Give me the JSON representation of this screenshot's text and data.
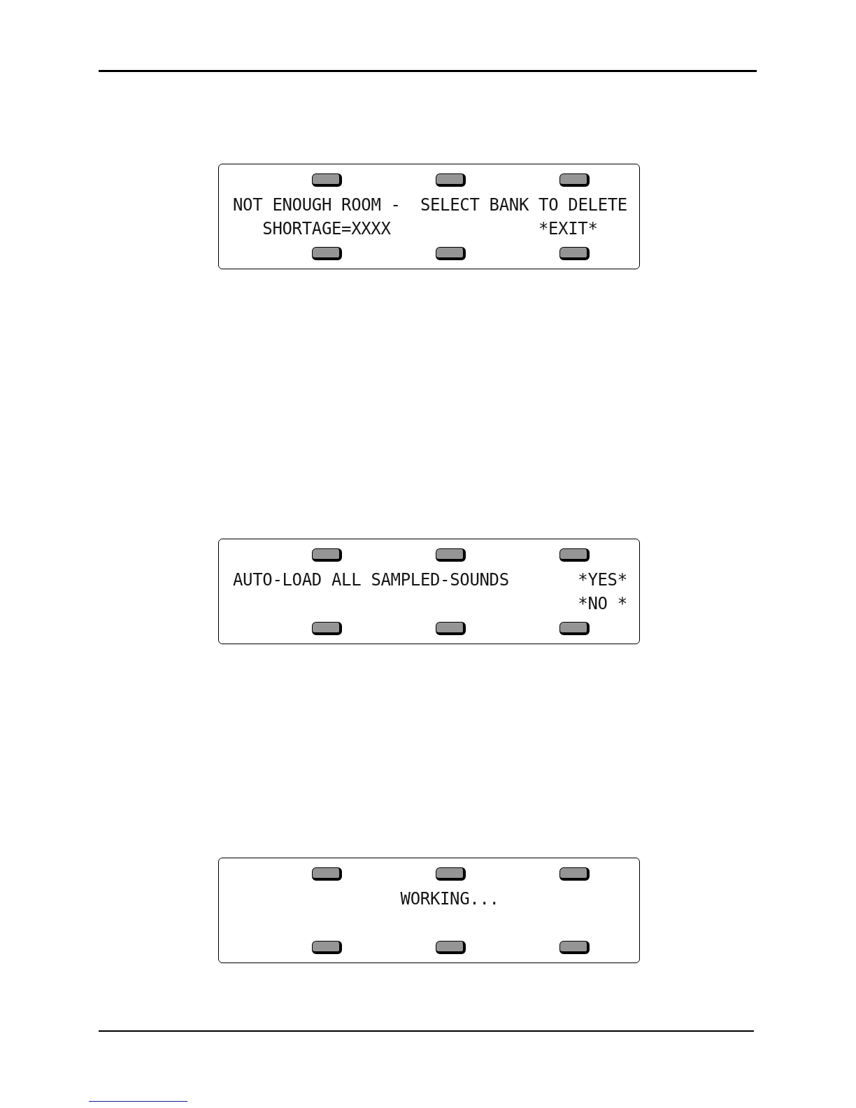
{
  "displays": [
    {
      "lines": [
        [
          "NOT ENOUGH ROOM -  SELECT BANK TO DELETE"
        ],
        [
          "SHORTAGE=XXXX",
          "*EXIT*"
        ]
      ]
    },
    {
      "lines": [
        [
          "AUTO-LOAD ALL SAMPLED-SOUNDS",
          "*YES*"
        ],
        [
          "*NO *"
        ]
      ]
    },
    {
      "lines": [
        [
          "WORKING..."
        ]
      ]
    }
  ]
}
